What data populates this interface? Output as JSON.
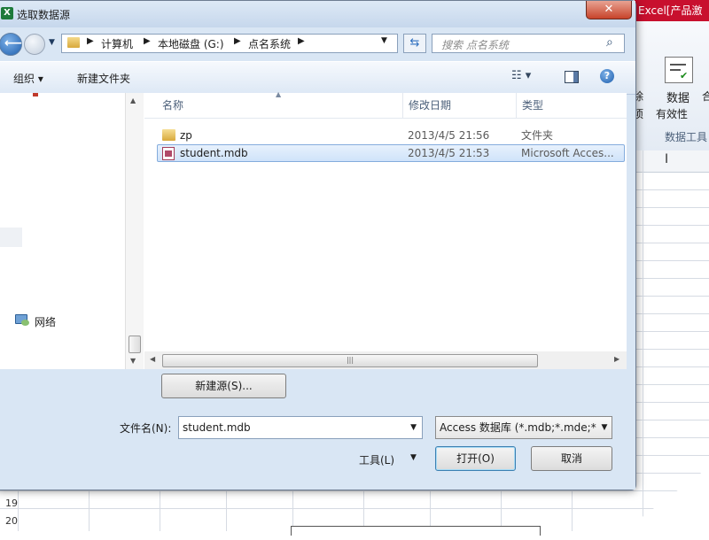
{
  "dialog": {
    "title": "选取数据源",
    "close_glyph": "✕",
    "nav": {
      "path": [
        "计算机",
        "本地磁盘 (G:)",
        "点名系统"
      ],
      "search_placeholder": "搜索 点名系统"
    },
    "toolbar": {
      "organize": "组织 ▾",
      "new_folder": "新建文件夹"
    },
    "sidebar": {
      "network_label": "网络"
    },
    "columns": [
      "名称",
      "修改日期",
      "类型"
    ],
    "files": [
      {
        "name": "zp",
        "date": "2013/4/5 21:56",
        "type": "文件夹",
        "icon": "folder-icon"
      },
      {
        "name": "student.mdb",
        "date": "2013/4/5 21:53",
        "type": "Microsoft Acces...",
        "icon": "access-file-icon"
      }
    ],
    "new_source_button": "新建源(S)...",
    "filename_label": "文件名(N):",
    "filename_value": "student.mdb",
    "filetype_value": "Access 数据库 (*.mdb;*.mde;*",
    "tools_label": "工具(L)",
    "open_button": "打开(O)",
    "cancel_button": "取消"
  },
  "excel": {
    "title_fragment": "Excel[产品激",
    "ribbon_label_1": "数据",
    "ribbon_label_2": "有效性",
    "ribbon_left_top": "除",
    "ribbon_left_bottom": "项",
    "ribbon_group_label": "数据工具",
    "ribbon_right_fragment": "合",
    "row_numbers": [
      "19",
      "20"
    ]
  },
  "colors": {
    "dialog_frame": "#d9e6f4",
    "selection": "#cfe3fa",
    "excel_red": "#c8102e"
  }
}
